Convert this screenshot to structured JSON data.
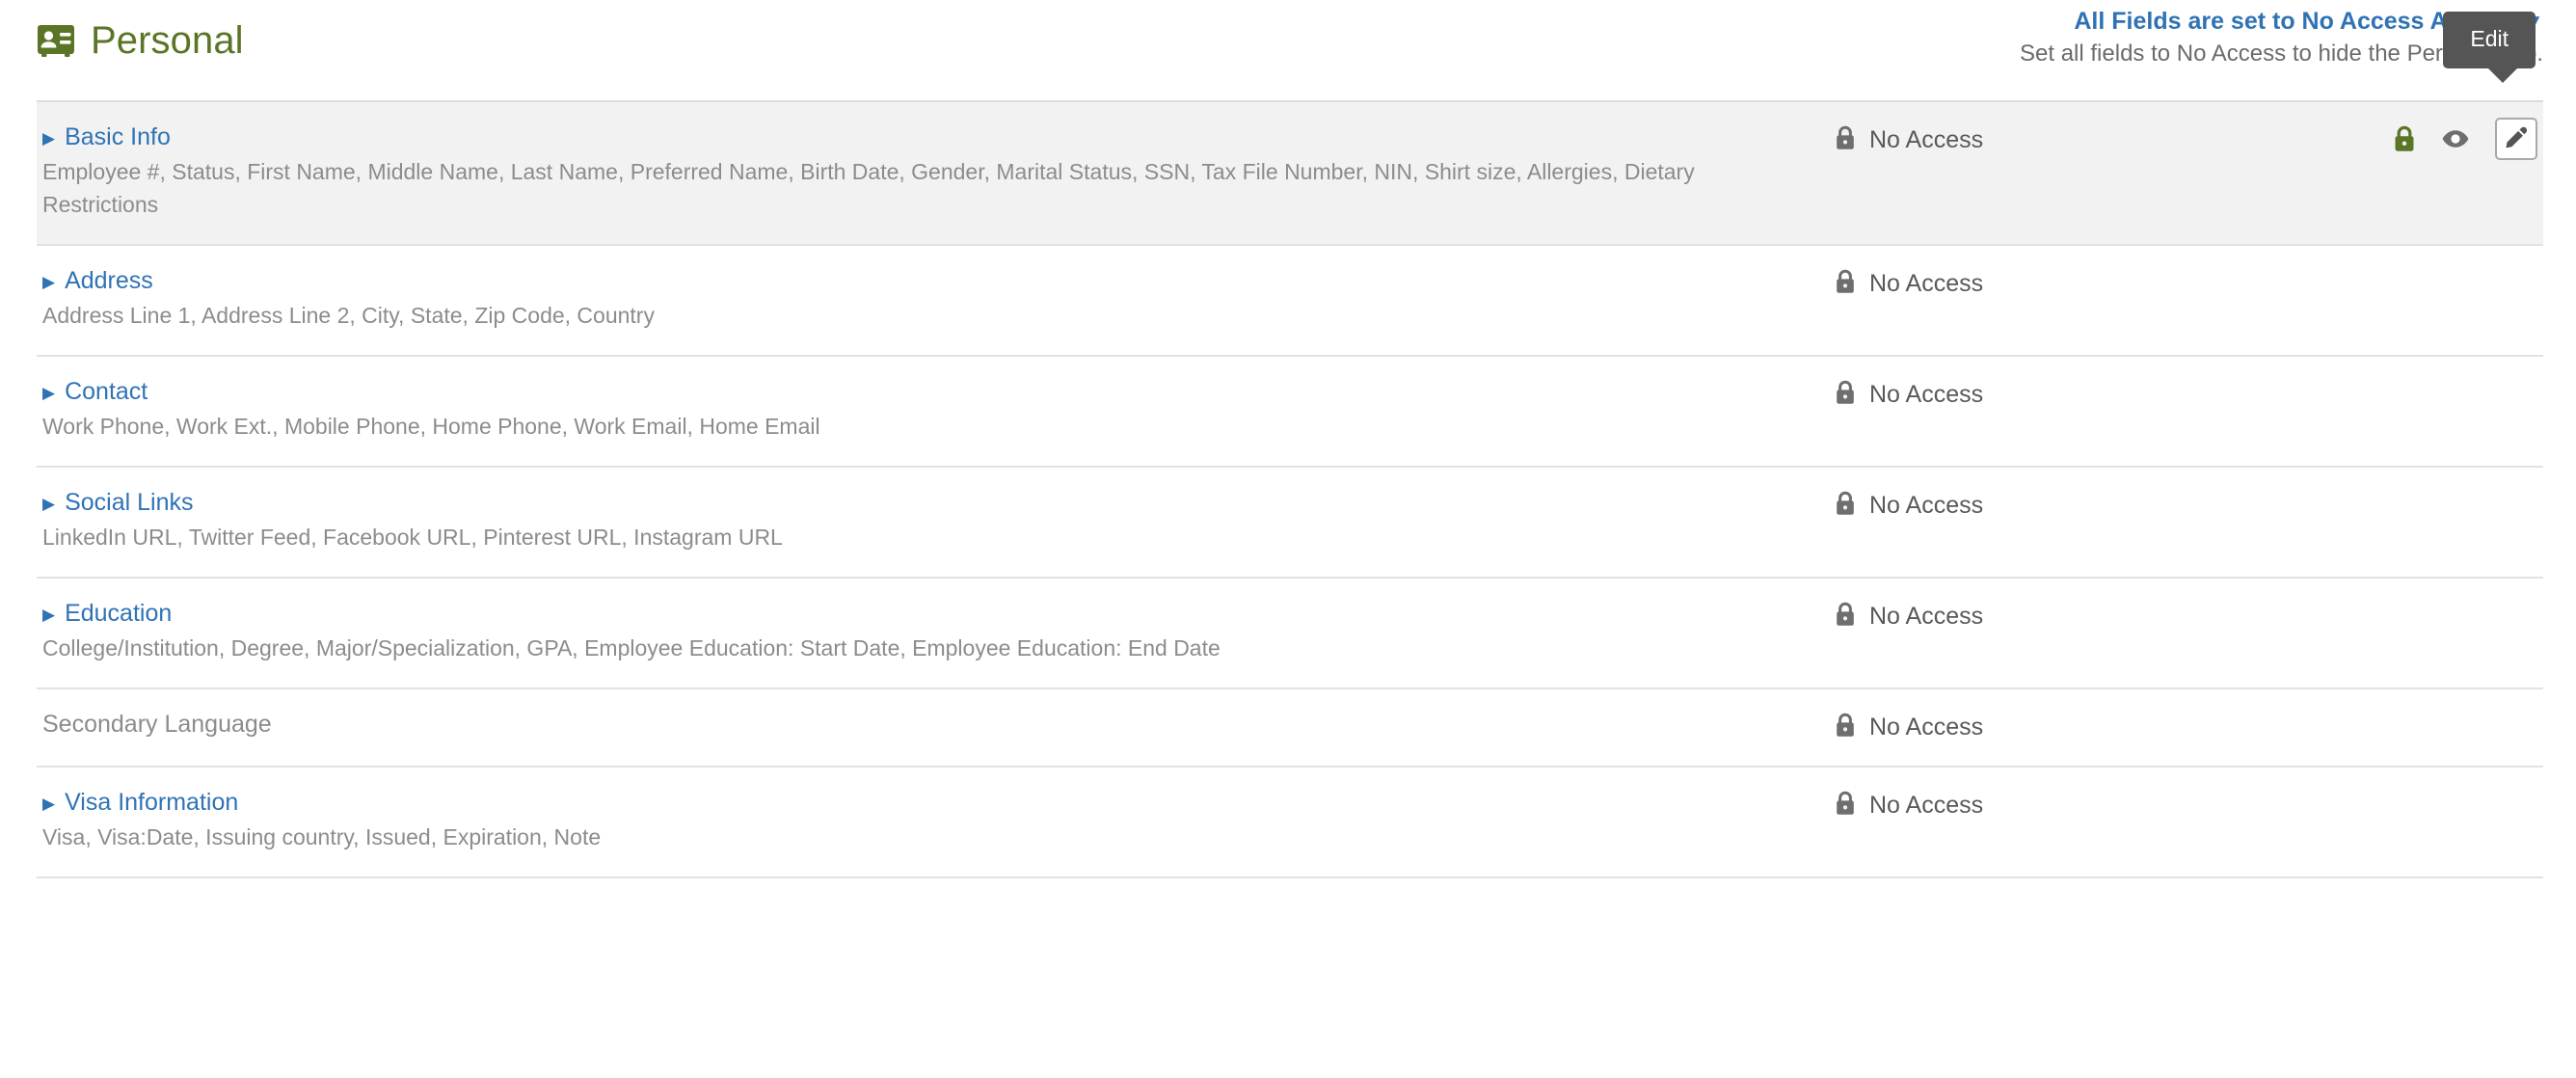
{
  "header": {
    "icon": "id-badge-icon",
    "title": "Personal",
    "brand_color": "#5b7526",
    "link_color": "#2f73b5",
    "all_fields_link": "All Fields are set to No Access Already",
    "all_fields_caret": "▼",
    "all_fields_hint": "Set all fields to No Access to hide the Personal tab."
  },
  "tooltip": {
    "label": "Edit",
    "background": "#555555"
  },
  "access": {
    "lock_icon": "lock-icon",
    "no_access_label": "No Access"
  },
  "actions": {
    "lock_icon": "lock-icon",
    "lock_color": "#5b7526",
    "view_icon": "eye-icon",
    "view_color": "#6e6e6e",
    "edit_icon": "pencil-icon",
    "edit_color": "#555555"
  },
  "sections": [
    {
      "title": "Basic Info",
      "fields": "Employee #, Status, First Name, Middle Name, Last Name, Preferred Name, Birth Date, Gender, Marital Status, SSN, Tax File Number, NIN, Shirt size, Allergies, Dietary Restrictions",
      "access": "No Access",
      "disclosure": "▶",
      "highlighted": true,
      "linked": true,
      "has_actions": true
    },
    {
      "title": "Address",
      "fields": "Address Line 1, Address Line 2, City, State, Zip Code, Country",
      "access": "No Access",
      "disclosure": "▶",
      "highlighted": false,
      "linked": true,
      "has_actions": false
    },
    {
      "title": "Contact",
      "fields": "Work Phone, Work Ext., Mobile Phone, Home Phone, Work Email, Home Email",
      "access": "No Access",
      "disclosure": "▶",
      "highlighted": false,
      "linked": true,
      "has_actions": false
    },
    {
      "title": "Social Links",
      "fields": "LinkedIn URL, Twitter Feed, Facebook URL, Pinterest URL, Instagram URL",
      "access": "No Access",
      "disclosure": "▶",
      "highlighted": false,
      "linked": true,
      "has_actions": false
    },
    {
      "title": "Education",
      "fields": "College/Institution, Degree, Major/Specialization, GPA, Employee Education: Start Date, Employee Education: End Date",
      "access": "No Access",
      "disclosure": "▶",
      "highlighted": false,
      "linked": true,
      "has_actions": false
    },
    {
      "title": "Secondary Language",
      "fields": "",
      "access": "No Access",
      "disclosure": "",
      "highlighted": false,
      "linked": false,
      "has_actions": false
    },
    {
      "title": "Visa Information",
      "fields": "Visa, Visa:Date, Issuing country, Issued, Expiration, Note",
      "access": "No Access",
      "disclosure": "▶",
      "highlighted": false,
      "linked": true,
      "has_actions": false
    }
  ]
}
